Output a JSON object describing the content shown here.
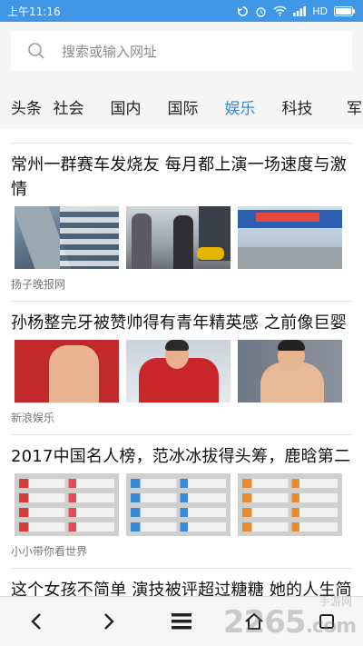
{
  "status_bar": {
    "time": "上午11:16",
    "network": "HD"
  },
  "search": {
    "placeholder": "搜索或输入网址"
  },
  "tabs": [
    {
      "label": "头条"
    },
    {
      "label": "社会"
    },
    {
      "label": "国内"
    },
    {
      "label": "国际"
    },
    {
      "label": "娱乐",
      "active": true
    },
    {
      "label": "科技"
    },
    {
      "label": "军"
    }
  ],
  "articles": [
    {
      "title": "常州一群赛车发烧友 每月都上演一场速度与激情",
      "source": "扬子晚报网"
    },
    {
      "title": "孙杨整完牙被赞帅得有青年精英感 之前像巨婴",
      "source": "新浪娱乐"
    },
    {
      "title": "2017中国名人榜，范冰冰拔得头筹，鹿晗第二",
      "source": "小小带你看世界"
    },
    {
      "title": "这个女孩不简单 演技被评超过糖糖 她的人生简直开挂了"
    }
  ],
  "watermark": {
    "text": "2265",
    "sub": "手游网",
    "suffix": ".com"
  },
  "colors": {
    "status_bar": "#3f97e6",
    "active_tab": "#2b8ae6"
  }
}
